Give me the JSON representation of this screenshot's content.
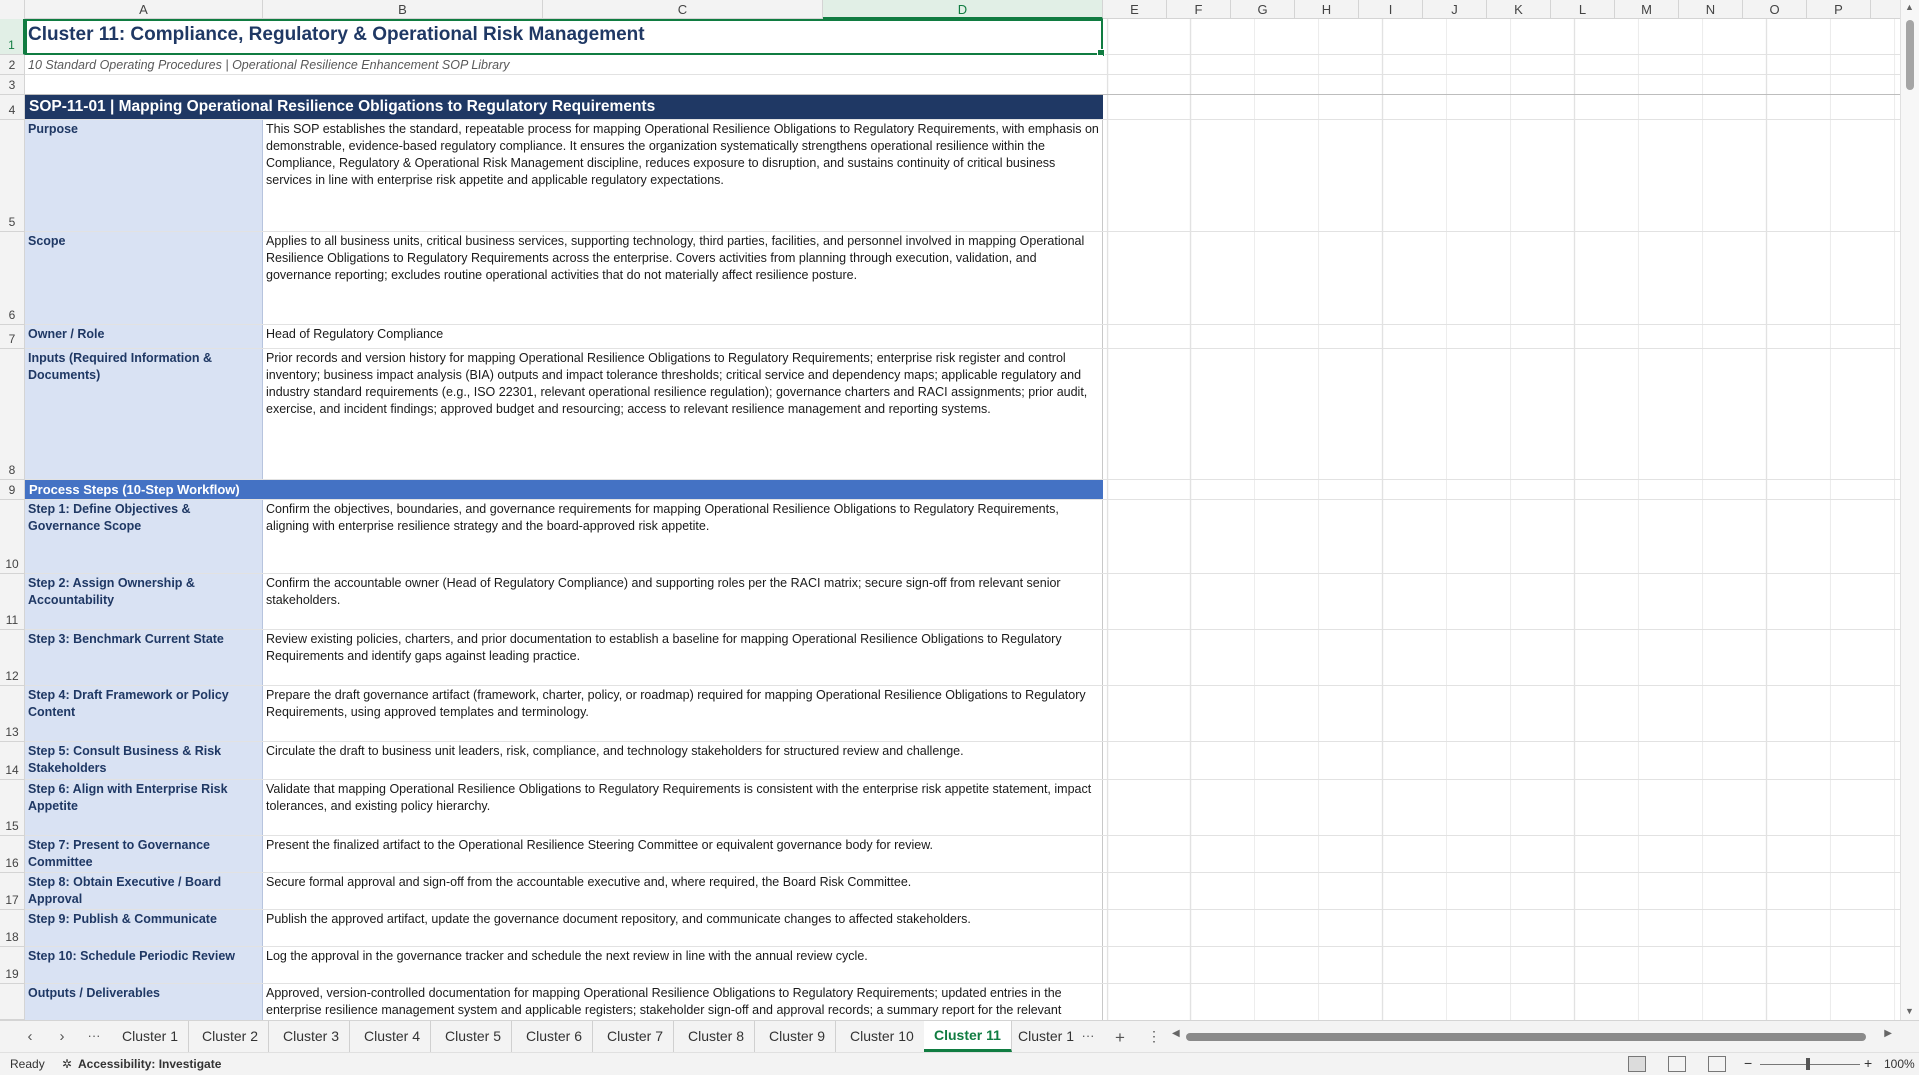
{
  "columns": [
    "A",
    "B",
    "C",
    "D",
    "E",
    "F",
    "G",
    "H",
    "I",
    "J",
    "K",
    "L",
    "M",
    "N",
    "O",
    "P"
  ],
  "selected_column": "D",
  "rows": {
    "numbers": [
      "1",
      "2",
      "3",
      "4",
      "5",
      "6",
      "7",
      "8",
      "9",
      "10",
      "11",
      "12",
      "13",
      "14",
      "15",
      "16",
      "17",
      "18",
      "19"
    ],
    "selected_row": "1"
  },
  "sheet": {
    "title": "Cluster 11: Compliance, Regulatory & Operational Risk Management",
    "subtitle": "10 Standard Operating Procedures | Operational Resilience Enhancement SOP Library",
    "sop_header": "SOP-11-01  |  Mapping Operational Resilience Obligations to Regulatory Requirements",
    "purpose_label": "Purpose",
    "purpose_text": "This SOP establishes the standard, repeatable process for mapping Operational Resilience Obligations to Regulatory Requirements, with emphasis on demonstrable, evidence-based regulatory compliance. It ensures the organization systematically strengthens operational resilience within the Compliance, Regulatory & Operational Risk Management discipline, reduces exposure to disruption, and sustains continuity of critical business services in line with enterprise risk appetite and applicable regulatory expectations.",
    "scope_label": "Scope",
    "scope_text": "Applies to all business units, critical business services, supporting technology, third parties, facilities, and personnel involved in mapping Operational Resilience Obligations to Regulatory Requirements across the enterprise. Covers activities from planning through execution, validation, and governance reporting; excludes routine operational activities that do not materially affect resilience posture.",
    "owner_label": "Owner / Role",
    "owner_text": "Head of Regulatory Compliance",
    "inputs_label": "Inputs (Required Information & Documents)",
    "inputs_text": "Prior records and version history for mapping Operational Resilience Obligations to Regulatory Requirements; enterprise risk register and control inventory; business impact analysis (BIA) outputs and impact tolerance thresholds; critical service and dependency maps; applicable regulatory and industry standard requirements (e.g., ISO 22301, relevant operational resilience regulation); governance charters and RACI assignments; prior audit, exercise, and incident findings; approved budget and resourcing; access to relevant resilience management and reporting systems.",
    "process_header": "Process Steps (10-Step Workflow)",
    "steps": [
      {
        "label": "Step 1: Define Objectives & Governance Scope",
        "text": "Confirm the objectives, boundaries, and governance requirements for mapping Operational Resilience Obligations to Regulatory Requirements, aligning with enterprise resilience strategy and the board-approved risk appetite."
      },
      {
        "label": "Step 2: Assign Ownership & Accountability",
        "text": "Confirm the accountable owner (Head of Regulatory Compliance) and supporting roles per the RACI matrix; secure sign-off from relevant senior stakeholders."
      },
      {
        "label": "Step 3: Benchmark Current State",
        "text": "Review existing policies, charters, and prior documentation to establish a baseline for mapping Operational Resilience Obligations to Regulatory Requirements and identify gaps against leading practice."
      },
      {
        "label": "Step 4: Draft Framework or Policy Content",
        "text": "Prepare the draft governance artifact (framework, charter, policy, or roadmap) required for mapping Operational Resilience Obligations to Regulatory Requirements, using approved templates and terminology."
      },
      {
        "label": "Step 5: Consult Business & Risk Stakeholders",
        "text": "Circulate the draft to business unit leaders, risk, compliance, and technology stakeholders for structured review and challenge."
      },
      {
        "label": "Step 6: Align with Enterprise Risk Appetite",
        "text": "Validate that mapping Operational Resilience Obligations to Regulatory Requirements is consistent with the enterprise risk appetite statement, impact tolerances, and existing policy hierarchy."
      },
      {
        "label": "Step 7: Present to Governance Committee",
        "text": "Present the finalized artifact to the Operational Resilience Steering Committee or equivalent governance body for review."
      },
      {
        "label": "Step 8: Obtain Executive / Board Approval",
        "text": "Secure formal approval and sign-off from the accountable executive and, where required, the Board Risk Committee."
      },
      {
        "label": "Step 9: Publish & Communicate",
        "text": "Publish the approved artifact, update the governance document repository, and communicate changes to affected stakeholders."
      },
      {
        "label": "Step 10: Schedule Periodic Review",
        "text": "Log the approval in the governance tracker and schedule the next review in line with the annual review cycle."
      }
    ],
    "outputs_label": "Outputs / Deliverables",
    "outputs_text": "Approved, version-controlled documentation for mapping Operational Resilience Obligations to Regulatory Requirements; updated entries in the enterprise resilience management system and applicable registers; stakeholder sign-off and approval records; a summary report for the relevant"
  },
  "tabs": {
    "items": [
      "Cluster 1",
      "Cluster 2",
      "Cluster 3",
      "Cluster 4",
      "Cluster 5",
      "Cluster 6",
      "Cluster 7",
      "Cluster 8",
      "Cluster 9",
      "Cluster 10",
      "Cluster 11",
      "Cluster 1"
    ],
    "active": "Cluster 11",
    "more": "···",
    "add": "+",
    "options": "⋮"
  },
  "status": {
    "ready": "Ready",
    "accessibility": "Accessibility: Investigate",
    "zoom": "100%"
  },
  "colors": {
    "title": "#1f3864",
    "band_dark": "#1f3864",
    "band_mid": "#4472c4",
    "label_bg": "#d9e2f3",
    "accent": "#107c41"
  }
}
